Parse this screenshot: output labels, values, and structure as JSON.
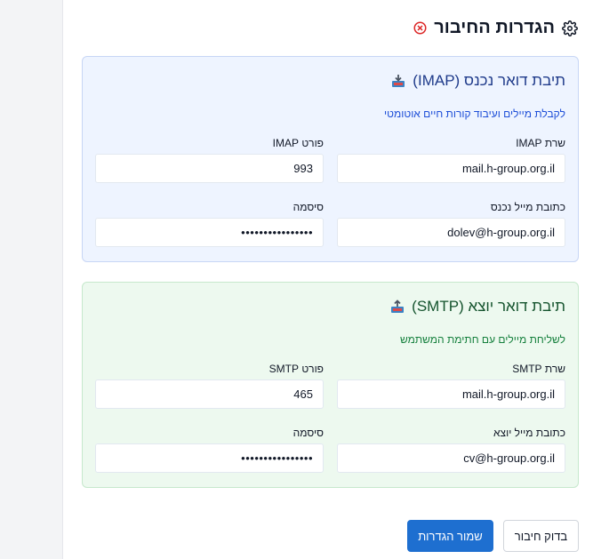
{
  "header": {
    "title": "הגדרות החיבור",
    "icon": "gear-icon",
    "close_icon": "close-circle-icon"
  },
  "imap": {
    "icon": "inbox-tray-icon",
    "title": "תיבת דואר נכנס (IMAP)",
    "subtitle": "לקבלת מיילים ועיבוד קורות חיים אוטומטי",
    "server_label": "שרת IMAP",
    "server_value": "mail.h-group.org.il",
    "port_label": "פורט IMAP",
    "port_value": "993",
    "email_label": "כתובת מייל נכנס",
    "email_value": "dolev@h-group.org.il",
    "password_label": "סיסמה",
    "password_value": "••••••••••••••••"
  },
  "smtp": {
    "icon": "outbox-tray-icon",
    "title": "תיבת דואר יוצא (SMTP)",
    "subtitle": "לשליחת מיילים עם חתימת המשתמש",
    "server_label": "שרת SMTP",
    "server_value": "mail.h-group.org.il",
    "port_label": "פורט SMTP",
    "port_value": "465",
    "email_label": "כתובת מייל יוצא",
    "email_value": "cv@h-group.org.il",
    "password_label": "סיסמה",
    "password_value": "••••••••••••••••"
  },
  "actions": {
    "save_label": "שמור הגדרות",
    "test_label": "בדוק חיבור"
  },
  "colors": {
    "primary": "#1e6fd0",
    "imap_bg": "#eef4ff",
    "smtp_bg": "#edf9ef",
    "close": "#dc2626"
  }
}
